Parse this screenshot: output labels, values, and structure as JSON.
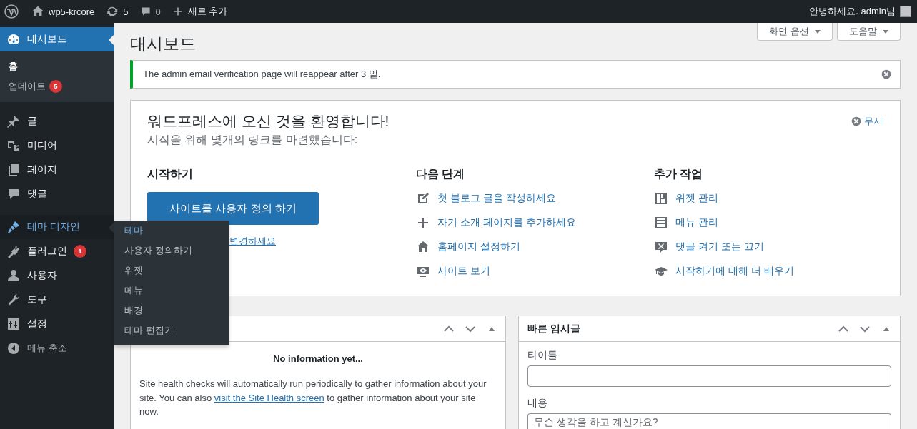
{
  "admin_bar": {
    "site": "wp5-krcore",
    "updates": "5",
    "comments": "0",
    "new_item": "새로 추가",
    "greeting": "안녕하세요. admin님"
  },
  "sidebar": {
    "items": [
      {
        "label": "대시보드",
        "selected": true,
        "highlighted": false,
        "children": [
          {
            "label": "홈",
            "selected": true
          },
          {
            "label": "업데이트",
            "selected": false,
            "badge": "5"
          }
        ]
      },
      {
        "label": "글",
        "selected": false,
        "highlighted": false
      },
      {
        "label": "미디어",
        "selected": false,
        "highlighted": false
      },
      {
        "label": "페이지",
        "selected": false,
        "highlighted": false
      },
      {
        "label": "댓글",
        "selected": false,
        "highlighted": false
      },
      {
        "label": "테마 디자인",
        "selected": false,
        "highlighted": true,
        "children": [
          {
            "label": "테마",
            "selected": true
          },
          {
            "label": "사용자 정의하기",
            "selected": false
          },
          {
            "label": "위젯",
            "selected": false
          },
          {
            "label": "메뉴",
            "selected": false
          },
          {
            "label": "배경",
            "selected": false
          },
          {
            "label": "테마 편집기",
            "selected": false
          }
        ]
      },
      {
        "label": "플러그인",
        "selected": false,
        "highlighted": false,
        "badge": "1"
      },
      {
        "label": "사용자",
        "selected": false,
        "highlighted": false
      },
      {
        "label": "도구",
        "selected": false,
        "highlighted": false
      },
      {
        "label": "설정",
        "selected": false,
        "highlighted": false
      },
      {
        "label": "메뉴 축소",
        "selected": false,
        "highlighted": false,
        "kind": "collapse"
      }
    ]
  },
  "screen_buttons": [
    "화면 옵션",
    "도움말"
  ],
  "page_title": "대시보드",
  "notice": {
    "text": "The admin email verification page will reappear after 3 일."
  },
  "welcome": {
    "title": "워드프레스에 오신 것을 환영합니다!",
    "subtitle": "시작을 위해 몇개의 링크를 마련했습니다:",
    "dismiss": "무시",
    "columns": [
      {
        "heading": "시작하기",
        "button": "사이트를 사용자 정의 하기",
        "link": "변경하세요"
      },
      {
        "heading": "다음 단계",
        "links": [
          "첫 블로그 글을 작성하세요",
          "자기 소개 페이지를 추가하세요",
          "홈페이지 설정하기",
          "사이트 보기"
        ]
      },
      {
        "heading": "추가 작업",
        "links": [
          "위젯 관리",
          "메뉴 관리",
          "댓글 켜기 또는 끄기",
          "시작하기에 대해 더 배우기"
        ]
      }
    ]
  },
  "widgets": [
    {
      "kind": "site-health",
      "status": "No information yet...",
      "text_before": "Site health checks will automatically run periodically to gather information about your site. You can also ",
      "link": "visit the Site Health screen",
      "text_after": " to gather information about your site now."
    },
    {
      "kind": "quick-draft",
      "title": "빠른 임시글",
      "fields": [
        {
          "label": "타이틀"
        },
        {
          "label": "내용",
          "placeholder": "무슨 생각을 하고 계신가요?"
        }
      ]
    }
  ]
}
